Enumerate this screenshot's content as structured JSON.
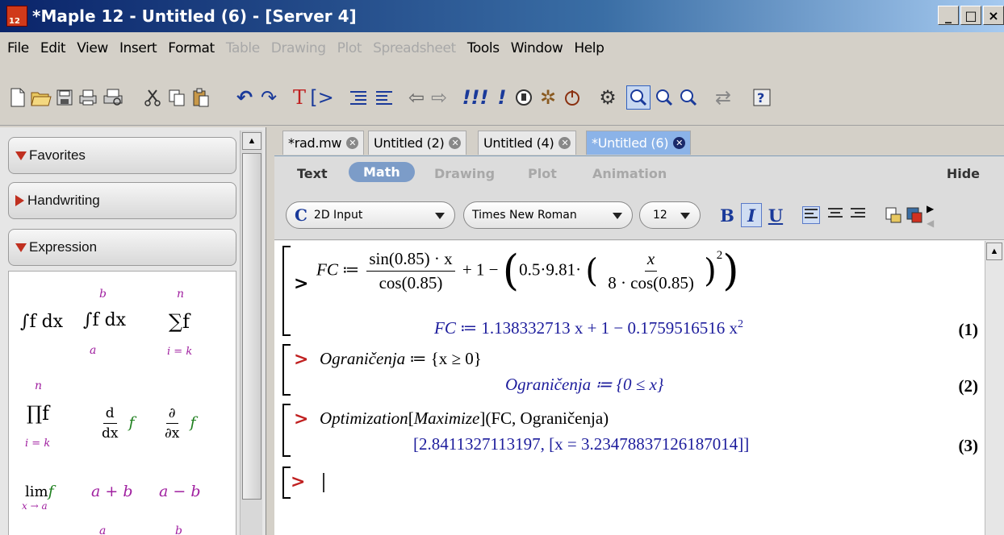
{
  "window": {
    "title": "*Maple 12 - Untitled (6) - [Server 4]",
    "controls": [
      "_",
      "□",
      "×"
    ]
  },
  "menu": {
    "file": "File",
    "edit": "Edit",
    "view": "View",
    "insert": "Insert",
    "format": "Format",
    "table": "Table",
    "drawing": "Drawing",
    "plot": "Plot",
    "spreadsheet": "Spreadsheet",
    "tools": "Tools",
    "window": "Window",
    "help": "Help"
  },
  "palettes": {
    "favorites": "Favorites",
    "handwriting": "Handwriting",
    "expression": "Expression",
    "symbols": {
      "integral": "∫f dx",
      "def_integral": "∫f dx",
      "def_upper": "b",
      "def_lower": "a",
      "sum": "∑f",
      "sum_upper": "n",
      "sum_lower": "i = k",
      "product": "∏f",
      "prod_upper": "n",
      "prod_lower": "i = k",
      "derivative_num": "d",
      "derivative_den": "dx",
      "derivative_f": "f",
      "partial_num": "∂",
      "partial_den": "∂x",
      "partial_f": "f",
      "limit": "lim",
      "limit_sub": "x → a",
      "limit_f": "f",
      "plus": "a + b",
      "minus": "a − b",
      "partial_a": "a",
      "partial_b": "b"
    }
  },
  "tabs": [
    {
      "label": "*rad.mw",
      "active": false
    },
    {
      "label": "Untitled (2)",
      "active": false
    },
    {
      "label": "Untitled (4)",
      "active": false
    },
    {
      "label": "*Untitled (6)",
      "active": true
    }
  ],
  "context_bar": {
    "text": "Text",
    "math": "Math",
    "drawing": "Drawing",
    "plot": "Plot",
    "animation": "Animation",
    "hide": "Hide"
  },
  "format_bar": {
    "mode_icon": "C",
    "mode": "2D Input",
    "font": "Times New Roman",
    "size": "12",
    "bold": "B",
    "italic": "I",
    "underline": "U"
  },
  "worksheet": {
    "prompt": ">",
    "inputs": {
      "fc_lhs": "FC",
      "assign": "≔",
      "sin_num": "sin(0.85) · x",
      "cos_den": "cos(0.85)",
      "plus_one_minus": "+ 1 −",
      "coef": "0.5·9.81·",
      "x_num": "x",
      "cos8_den": "8 · cos(0.85)",
      "exp2": "2",
      "ogr_lhs": "Ograničenja",
      "ogr_rhs": "{x ≥ 0}",
      "opt_cmd": "Optimization",
      "opt_bracket": "Maximize",
      "opt_args": "(FC, Ograničenja)"
    },
    "outputs": {
      "out1_lhs": "FC",
      "out1_rhs": "≔ 1.138332713 x + 1 − 0.1759516516 x",
      "out1_exp": "2",
      "out2": "Ograničenja ≔ {0 ≤ x}",
      "out3": "[2.8411327113197, [x = 3.23478837126187014]]"
    },
    "equation_labels": [
      "(1)",
      "(2)",
      "(3)"
    ]
  }
}
